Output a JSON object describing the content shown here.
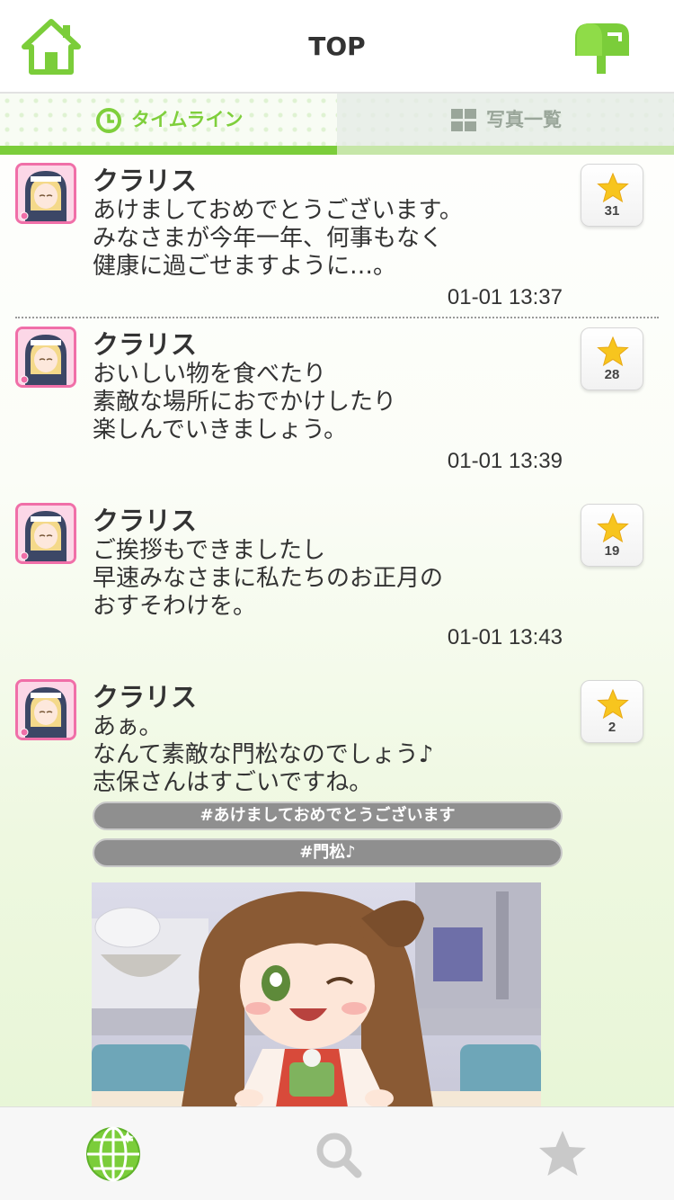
{
  "header": {
    "title": "TOP",
    "home_icon": "home-icon",
    "mail_icon": "mailbox-icon"
  },
  "tabs": [
    {
      "label": "タイムライン",
      "icon": "clock-icon",
      "active": true
    },
    {
      "label": "写真一覧",
      "icon": "grid-icon",
      "active": false
    }
  ],
  "posts": [
    {
      "user": "クラリス",
      "text": "あけましておめでとうございます。\nみなさまが今年一年、何事もなく\n健康に過ごせますように…。",
      "time": "01-01 13:37",
      "stars": "31"
    },
    {
      "user": "クラリス",
      "text": "おいしい物を食べたり\n素敵な場所におでかけしたり\n楽しんでいきましょう。",
      "time": "01-01 13:39",
      "stars": "28"
    },
    {
      "user": "クラリス",
      "text": "ご挨拶もできましたし\n早速みなさまに私たちのお正月の\nおすそわけを。",
      "time": "01-01 13:43",
      "stars": "19"
    },
    {
      "user": "クラリス",
      "text": "あぁ。\nなんて素敵な門松なのでしょう♪\n志保さんはすごいですね。",
      "stars": "2",
      "tags": [
        "#あけましておめでとうございます",
        "#門松♪"
      ]
    }
  ],
  "bottom_nav": [
    {
      "icon": "globe-icon",
      "active": true
    },
    {
      "icon": "search-icon",
      "active": false
    },
    {
      "icon": "star-icon",
      "active": false
    }
  ],
  "colors": {
    "accent_green": "#7bcd3a",
    "star_yellow": "#f7c51e",
    "tag_gray": "#8f8f8f",
    "avatar_pink": "#f06fa8"
  }
}
